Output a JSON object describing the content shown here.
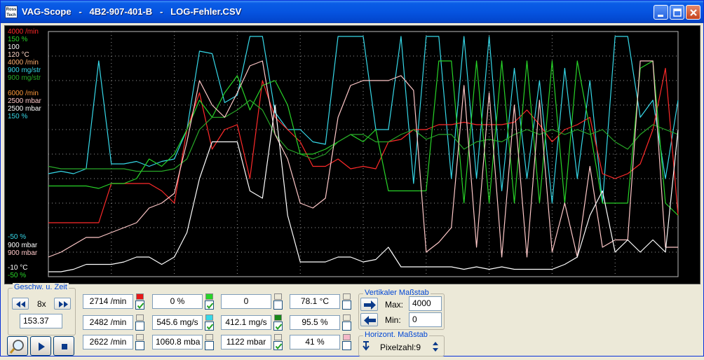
{
  "window": {
    "title": "VAG-Scope   -   4B2-907-401-B   -   LOG-Fehler.CSV",
    "logo_text": "Ross Tech"
  },
  "axis_labels": [
    {
      "text": "4000 /min",
      "color": "#ff2a2a"
    },
    {
      "text": "150 %",
      "color": "#28d428"
    },
    {
      "text": "100",
      "color": "#ffffff"
    },
    {
      "text": "120 °C",
      "color": "#ffd8c8"
    },
    {
      "text": "4000 /min",
      "color": "#ffb070"
    },
    {
      "text": "900 mg/str",
      "color": "#36d8e8"
    },
    {
      "text": "900 mg/str",
      "color": "#28a828"
    },
    {
      "text": "6000 /min",
      "color": "#ff9a3c"
    },
    {
      "text": "2500 mbar",
      "color": "#ffc8c8"
    },
    {
      "text": "2500 mbar",
      "color": "#ffffff"
    },
    {
      "text": "150 %",
      "color": "#36d8e8"
    },
    {
      "text": "-50 %",
      "color": "#36d8e8"
    },
    {
      "text": "900 mbar",
      "color": "#ffffff"
    },
    {
      "text": "900 mbar",
      "color": "#ffc8c8"
    },
    {
      "text": "-10 °C",
      "color": "#ffffff"
    },
    {
      "text": "-50 %",
      "color": "#28d428"
    }
  ],
  "chart_data": {
    "type": "line",
    "grid": true,
    "grid_style": "dotted",
    "x": [
      0,
      2,
      4,
      6,
      8,
      10,
      12,
      14,
      16,
      18,
      20,
      22,
      24,
      26,
      28,
      30,
      32,
      34,
      36,
      38,
      40,
      42,
      44,
      46,
      48,
      50,
      52,
      54,
      56,
      58,
      60,
      62,
      64,
      66,
      68,
      70,
      72,
      74,
      76,
      78,
      80,
      82,
      84,
      86,
      88,
      90,
      92,
      94,
      96,
      98,
      100
    ],
    "series": [
      {
        "color": "#36d8e8",
        "values": [
          42,
          43,
          42,
          44,
          88,
          46,
          46,
          47,
          45,
          47,
          48,
          60,
          92,
          91,
          71,
          74,
          98,
          98,
          67,
          60,
          60,
          55,
          54,
          98,
          98,
          98,
          60,
          60,
          98,
          38,
          98,
          98,
          40,
          98,
          40,
          98,
          35,
          85,
          40,
          80,
          30,
          85,
          40,
          80,
          30,
          98,
          98,
          65,
          72,
          40,
          72
        ]
      },
      {
        "color": "#ff2a2a",
        "values": [
          22,
          22,
          22,
          22,
          22,
          38,
          38,
          38,
          38,
          35,
          30,
          60,
          75,
          52,
          60,
          62,
          40,
          80,
          65,
          60,
          55,
          45,
          45,
          48,
          44,
          45,
          44,
          55,
          56,
          60,
          60,
          62,
          62,
          63,
          62,
          62,
          62,
          63,
          68,
          62,
          55,
          60,
          62,
          65,
          42,
          40,
          42,
          46,
          60,
          85,
          25
        ]
      },
      {
        "color": "#28d428",
        "values": [
          37,
          37,
          37,
          37,
          36,
          38,
          38,
          40,
          48,
          45,
          50,
          60,
          72,
          65,
          75,
          82,
          68,
          78,
          80,
          70,
          50,
          50,
          52,
          55,
          58,
          55,
          60,
          35,
          35,
          35,
          35,
          88,
          88,
          30,
          88,
          30,
          88,
          30,
          88,
          30,
          88,
          30,
          88,
          60,
          30,
          30,
          30,
          85,
          88,
          30,
          25
        ]
      },
      {
        "color": "#28a828",
        "values": [
          45,
          44,
          44,
          44,
          44,
          44,
          44,
          43,
          43,
          43,
          44,
          48,
          60,
          65,
          65,
          68,
          72,
          68,
          58,
          52,
          50,
          48,
          50,
          55,
          58,
          58,
          55,
          55,
          58,
          60,
          56,
          58,
          58,
          52,
          55,
          56,
          55,
          58,
          60,
          58,
          60,
          58,
          60,
          58,
          60,
          55,
          52,
          58,
          62,
          60,
          58
        ]
      },
      {
        "color": "#ffc8c8",
        "values": [
          8,
          10,
          13,
          16,
          16,
          18,
          20,
          22,
          28,
          30,
          34,
          55,
          80,
          70,
          65,
          75,
          86,
          88,
          58,
          48,
          30,
          28,
          32,
          65,
          78,
          80,
          80,
          80,
          82,
          76,
          10,
          14,
          20,
          78,
          12,
          75,
          8,
          70,
          8,
          72,
          10,
          30,
          8,
          45,
          12,
          15,
          15,
          88,
          88,
          12,
          12
        ]
      },
      {
        "color": "#ffffff",
        "values": [
          2,
          2,
          3,
          5,
          5,
          5,
          6,
          8,
          8,
          5,
          8,
          18,
          40,
          55,
          55,
          55,
          35,
          32,
          70,
          25,
          6,
          6,
          6,
          8,
          8,
          6,
          7,
          12,
          4,
          4,
          4,
          4,
          4,
          3,
          4,
          3,
          4,
          3,
          3,
          3,
          3,
          5,
          8,
          25,
          35,
          10,
          15,
          10,
          15,
          10,
          60
        ]
      }
    ]
  },
  "speed_group": {
    "title": "Geschw. u. Zeit",
    "speed": "8x",
    "time": "153.37"
  },
  "channels": [
    {
      "value": "2714 /min",
      "swatch": "#e81818",
      "checked": true
    },
    {
      "value": "0 %",
      "swatch": "#28d428",
      "checked": true
    },
    {
      "value": "0",
      "swatch": "#ece9d8",
      "checked": false
    },
    {
      "value": "78.1 °C",
      "swatch": "#ece9d8",
      "checked": false
    },
    {
      "value": "2482 /min",
      "swatch": "#ece9d8",
      "checked": false
    },
    {
      "value": "545.6 mg/s",
      "swatch": "#38d8e8",
      "checked": true
    },
    {
      "value": "412.1 mg/s",
      "swatch": "#188818",
      "checked": true
    },
    {
      "value": "95.5 %",
      "swatch": "#ece9d8",
      "checked": false
    },
    {
      "value": "2622 /min",
      "swatch": "#ece9d8",
      "checked": false
    },
    {
      "value": "1060.8 mba",
      "swatch": "#ece9d8",
      "checked": false
    },
    {
      "value": "1122 mbar",
      "swatch": "#ece9d8",
      "checked": true
    },
    {
      "value": "41 %",
      "swatch": "#f4b8c8",
      "checked": false
    }
  ],
  "vscale": {
    "title": "Vertikaler Maßstab",
    "max_label": "Max:",
    "max_value": "4000",
    "min_label": "Min:",
    "min_value": "0"
  },
  "hscale": {
    "title": "Horizont. Maßstab",
    "pixel_label": "Pixelzahl:9"
  }
}
